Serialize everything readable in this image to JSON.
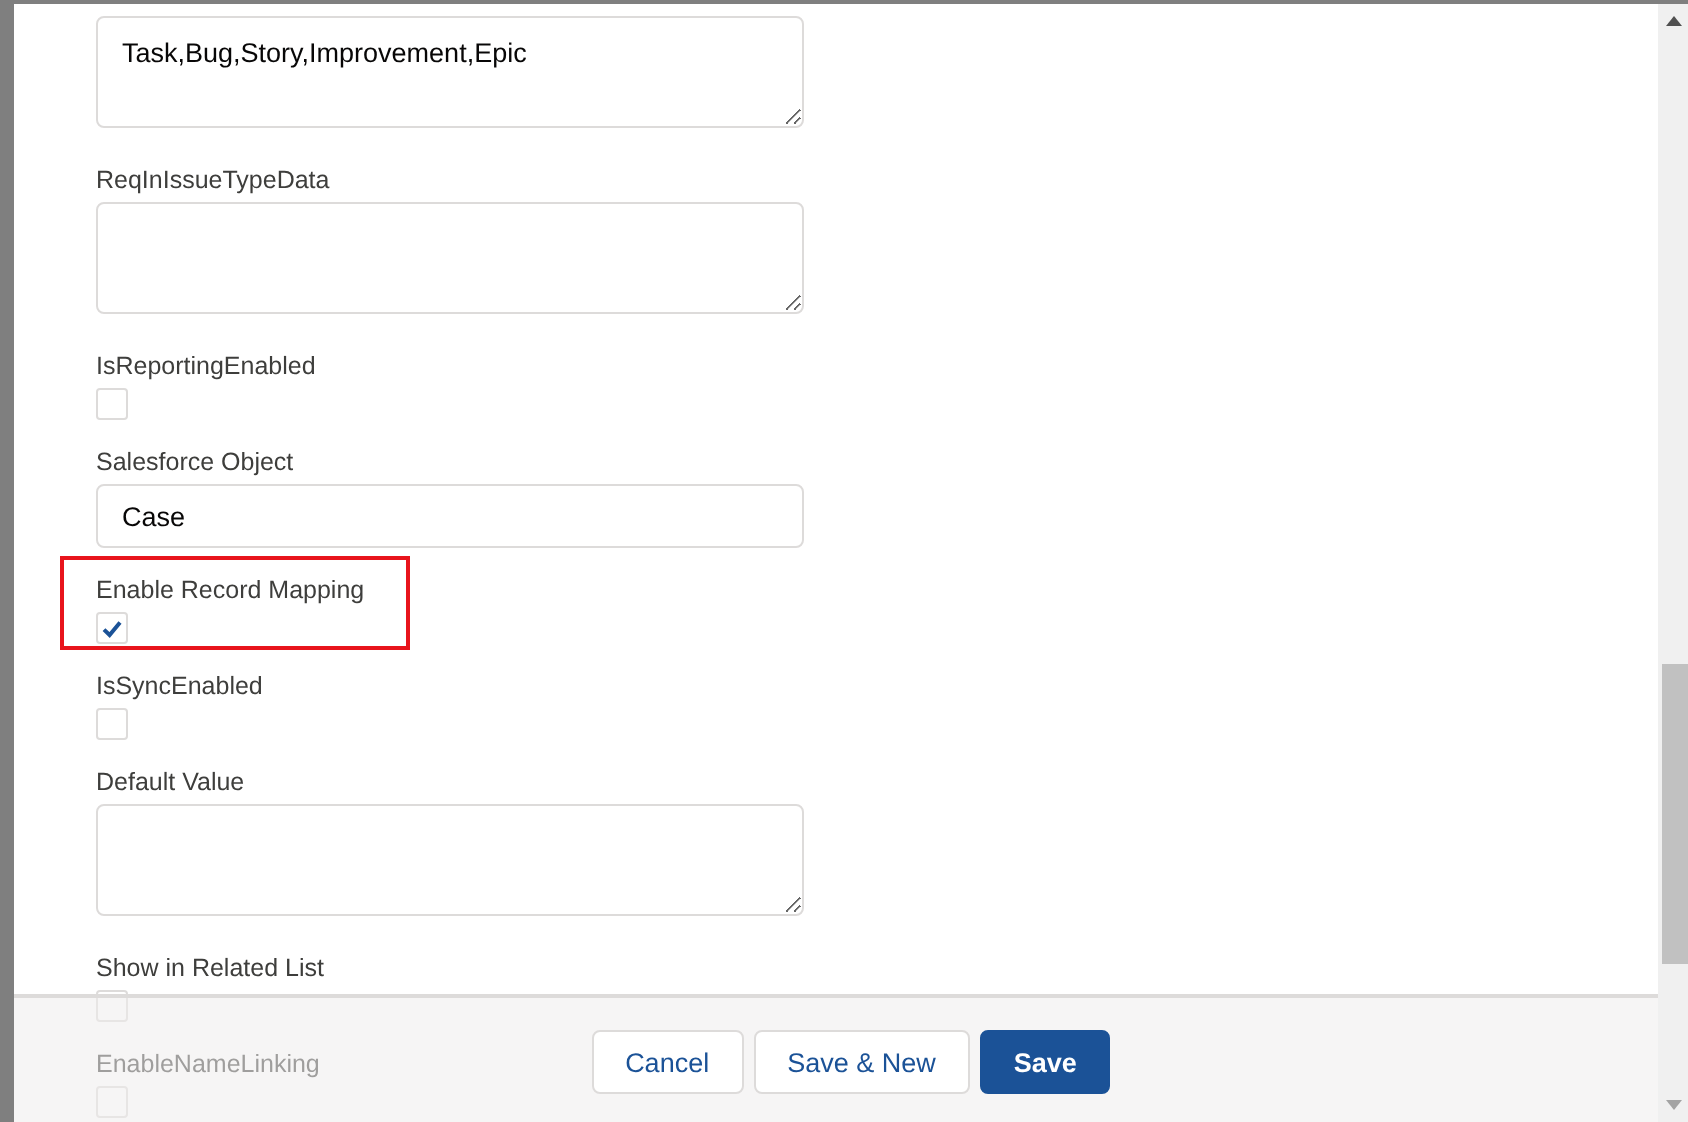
{
  "fields": [
    {
      "kind": "textarea",
      "value": "Task,Bug,Story,Improvement,Epic",
      "highlighted": false
    },
    {
      "kind": "textarea",
      "label": "ReqInIssueTypeData",
      "highlighted": false
    },
    {
      "kind": "checkbox",
      "label": "IsReportingEnabled",
      "checked": false,
      "highlighted": false
    },
    {
      "kind": "text",
      "label": "Salesforce Object",
      "value": "Case",
      "highlighted": false
    },
    {
      "kind": "checkbox",
      "label": "Enable Record Mapping",
      "checked": true,
      "highlighted": true
    },
    {
      "kind": "checkbox",
      "label": "IsSyncEnabled",
      "checked": false,
      "highlighted": false
    },
    {
      "kind": "textarea",
      "label": "Default Value",
      "highlighted": false
    },
    {
      "kind": "checkbox",
      "label": "Show in Related List",
      "checked": false,
      "highlighted": false
    },
    {
      "kind": "checkbox",
      "label": "EnableNameLinking",
      "checked": false,
      "highlighted": false
    }
  ],
  "footer": {
    "buttons": [
      {
        "label": "Cancel",
        "kind": "neutral"
      },
      {
        "label": "Save & New",
        "kind": "neutral"
      },
      {
        "label": "Save",
        "kind": "brand"
      }
    ]
  }
}
